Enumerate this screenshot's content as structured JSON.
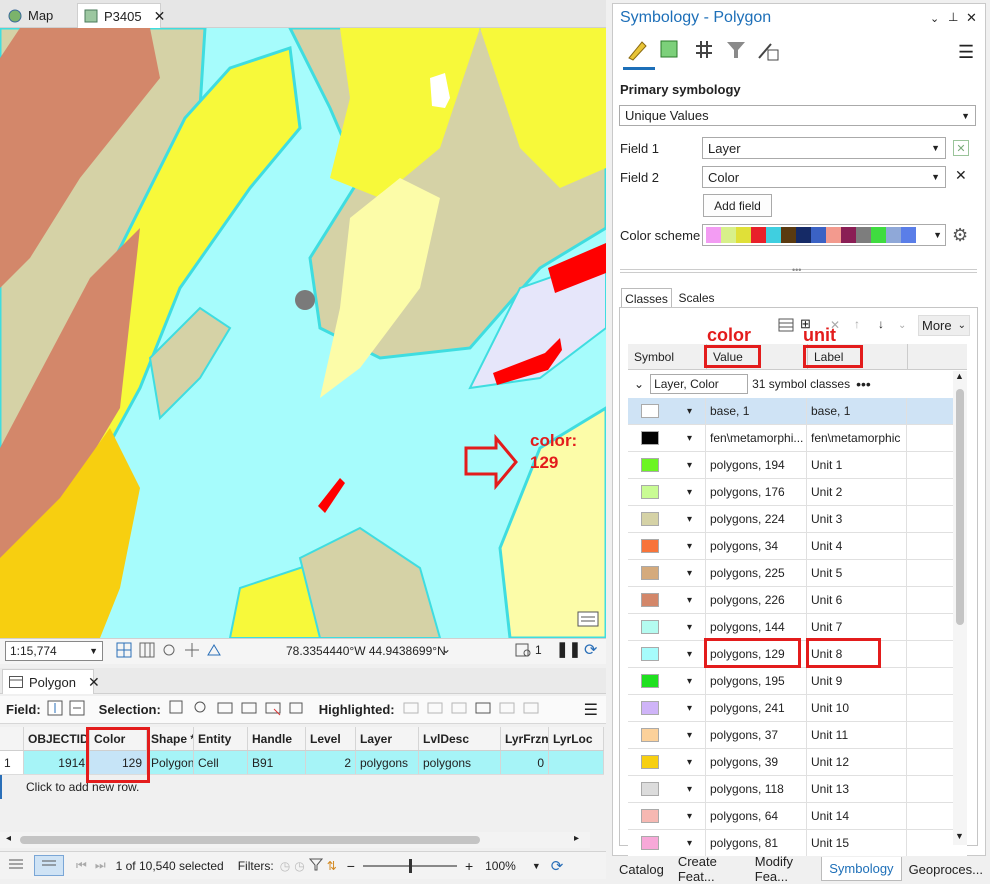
{
  "tabs": {
    "map": "Map",
    "p3405": "P3405"
  },
  "map": {
    "scale": "1:15,774",
    "coordinates": "78.3354440°W 44.9438699°N",
    "annotation_line1": "color:",
    "annotation_line2": "129"
  },
  "table_pane": {
    "tab_label": "Polygon",
    "field_label": "Field:",
    "selection_label": "Selection:",
    "highlighted_label": "Highlighted:",
    "columns": [
      "OBJECTID *",
      "Color",
      "Shape *",
      "Entity",
      "Handle",
      "Level",
      "Layer",
      "LvlDesc",
      "LyrFrzn",
      "LyrLoc"
    ],
    "row": {
      "num": "1",
      "objectid": "1914",
      "color": "129",
      "shape": "Polygon",
      "entity": "Cell",
      "handle": "B91",
      "level": "2",
      "layer": "polygons",
      "lvldesc": "polygons",
      "lyrfrzn": "0"
    },
    "add_row_text": "Click to add new row.",
    "selected_text": "1 of 10,540 selected",
    "filters_label": "Filters:",
    "zoom": "100%"
  },
  "symbology": {
    "title": "Symbology - Polygon",
    "primary_label": "Primary symbology",
    "primary_value": "Unique Values",
    "field1_label": "Field 1",
    "field1_value": "Layer",
    "field2_label": "Field 2",
    "field2_value": "Color",
    "add_field": "Add field",
    "color_scheme_label": "Color scheme",
    "scheme_colors": [
      "#f39cf3",
      "#d8f08a",
      "#e0e038",
      "#e8202a",
      "#3fcfe0",
      "#5a3a10",
      "#152a66",
      "#3b62c4",
      "#f39a8e",
      "#8a1e55",
      "#7d7d7d",
      "#3fdc3f",
      "#8fa8d8",
      "#5a7ee8"
    ],
    "tab_classes": "Classes",
    "tab_scales": "Scales",
    "more_label": "More",
    "col_symbol": "Symbol",
    "col_value": "Value",
    "col_label": "Label",
    "annot_color": "color",
    "annot_unit": "unit",
    "group_name": "Layer, Color",
    "group_count": "31 symbol classes",
    "rows": [
      {
        "color": "#ffffff",
        "value": "base, 1",
        "label": "base, 1"
      },
      {
        "color": "#000000",
        "value": "fen\\metamorphi...",
        "label": "fen\\metamorphic"
      },
      {
        "color": "#6cf522",
        "value": "polygons, 194",
        "label": "Unit 1"
      },
      {
        "color": "#c9fb94",
        "value": "polygons, 176",
        "label": "Unit 2"
      },
      {
        "color": "#d5d2a6",
        "value": "polygons, 224",
        "label": "Unit 3"
      },
      {
        "color": "#f8743a",
        "value": "polygons, 34",
        "label": "Unit 4"
      },
      {
        "color": "#d4aa7c",
        "value": "polygons, 225",
        "label": "Unit 5"
      },
      {
        "color": "#d3876a",
        "value": "polygons, 226",
        "label": "Unit 6"
      },
      {
        "color": "#b4fbf0",
        "value": "polygons, 144",
        "label": "Unit 7"
      },
      {
        "color": "#a6fcfc",
        "value": "polygons, 129",
        "label": "Unit 8"
      },
      {
        "color": "#1fe01f",
        "value": "polygons, 195",
        "label": "Unit 9"
      },
      {
        "color": "#cfb4f8",
        "value": "polygons, 241",
        "label": "Unit 10"
      },
      {
        "color": "#fcd19a",
        "value": "polygons, 37",
        "label": "Unit 11"
      },
      {
        "color": "#f7cf10",
        "value": "polygons, 39",
        "label": "Unit 12"
      },
      {
        "color": "#dcdcdc",
        "value": "polygons, 118",
        "label": "Unit 13"
      },
      {
        "color": "#f6b8b2",
        "value": "polygons, 64",
        "label": "Unit 14"
      },
      {
        "color": "#f7a8d8",
        "value": "polygons, 81",
        "label": "Unit 15"
      }
    ]
  },
  "bottom_tabs": [
    "Catalog",
    "Create Feat...",
    "Modify Fea...",
    "Symbology",
    "Geoproces..."
  ]
}
